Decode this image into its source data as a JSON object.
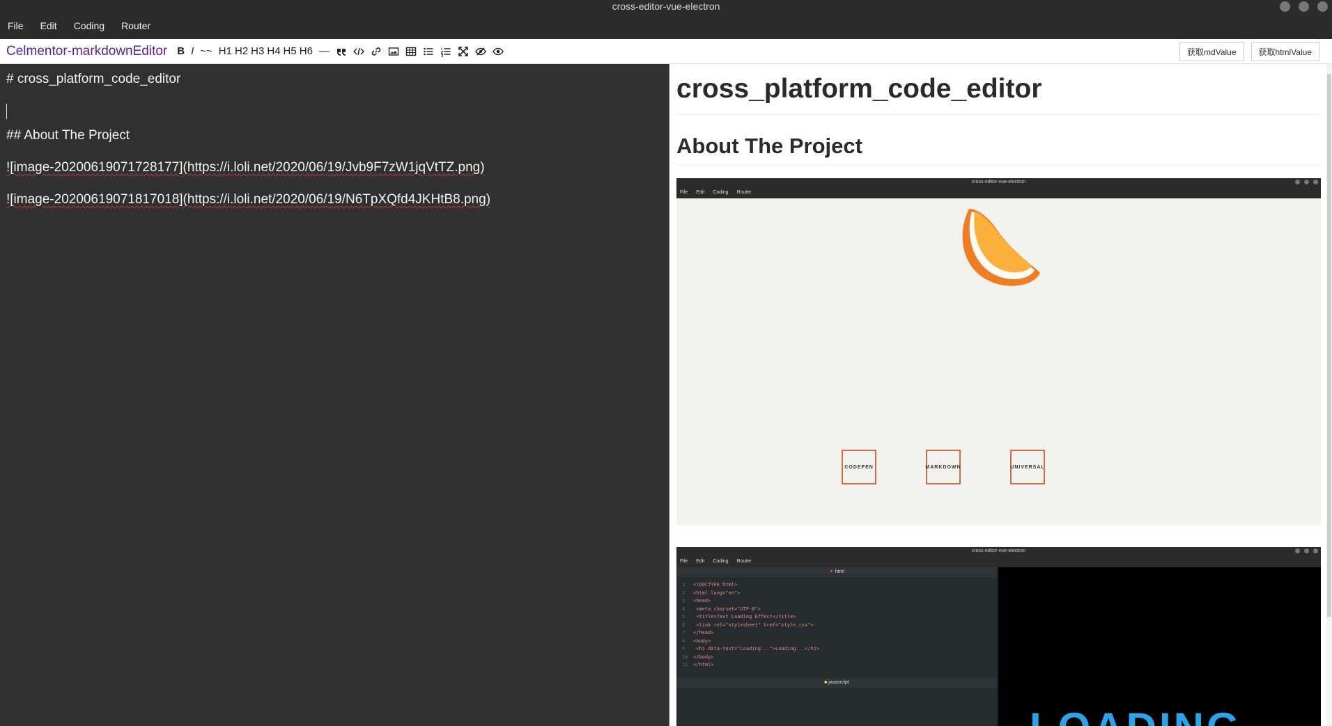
{
  "window": {
    "title": "cross-editor-vue-electron"
  },
  "menu": [
    "File",
    "Edit",
    "Coding",
    "Router"
  ],
  "toolbar": {
    "brand": "Celmentor-markdownEditor",
    "bold": "B",
    "italic": "I",
    "strike": "~~",
    "headings": [
      "H1",
      "H2",
      "H3",
      "H4",
      "H5",
      "H6"
    ],
    "hr": "—",
    "get_md": "获取mdValue",
    "get_html": "获取htmlValue"
  },
  "editor": {
    "lines": [
      "# cross_platform_code_editor",
      "",
      "## About The Project",
      "![image-20200619071728177](https://i.loli.net/2020/06/19/Jvb9F7zW1jqVtTZ.png)",
      "![image-20200619071817018](https://i.loli.net/2020/06/19/N6TpXQfd4JKHtB8.png)"
    ]
  },
  "preview": {
    "h1": "cross_platform_code_editor",
    "h2": "About The Project",
    "shot1": {
      "title": "cross-editor-vue-electron",
      "menu": [
        "File",
        "Edit",
        "Coding",
        "Router"
      ],
      "features": [
        "CODEPEN",
        "MARKDOWN",
        "UNIVERSAL"
      ]
    },
    "shot2": {
      "title": "cross-editor-vue-electron",
      "menu": [
        "File",
        "Edit",
        "Coding",
        "Router"
      ],
      "html_tab": "html",
      "js_tab": "javascript",
      "code": [
        "<!DOCTYPE html>",
        "<html lang=\"en\">",
        "<head>",
        "  <meta charset=\"UTF-8\">",
        "  <title>Text Loading Effect</title>",
        "  <link rel=\"stylesheet\" href=\"style.css\">",
        "</head>",
        "<body>",
        "  <h1 data-text=\"Loading...\">Loading...</h1>",
        "</body>",
        "</html>"
      ],
      "output_text": "LOADING"
    }
  }
}
